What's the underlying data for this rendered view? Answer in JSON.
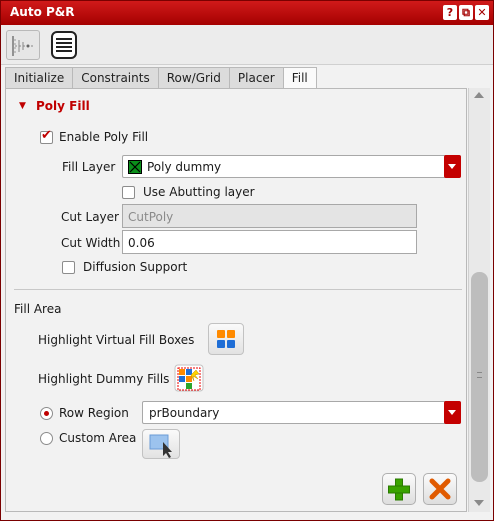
{
  "window": {
    "title": "Auto P&R",
    "buttons": [
      "?",
      "⧉",
      "✕"
    ]
  },
  "toolbar": {
    "icons": [
      "tree-view-icon",
      "list-view-icon"
    ]
  },
  "tabs": [
    {
      "label": "Initialize"
    },
    {
      "label": "Constraints"
    },
    {
      "label": "Row/Grid"
    },
    {
      "label": "Placer"
    },
    {
      "label": "Fill",
      "active": true
    }
  ],
  "poly_fill": {
    "section_title": "Poly Fill",
    "enable_label": "Enable Poly Fill",
    "enable_checked": true,
    "fill_layer_label": "Fill Layer",
    "fill_layer_value": "Poly dummy",
    "use_abutting_label": "Use Abutting layer",
    "use_abutting_checked": false,
    "cut_layer_label": "Cut Layer",
    "cut_layer_value": "CutPoly",
    "cut_width_label": "Cut Width",
    "cut_width_value": "0.06",
    "diffusion_label": "Diffusion Support",
    "diffusion_checked": false
  },
  "fill_area": {
    "section_title": "Fill Area",
    "highlight_virtual_label": "Highlight Virtual Fill Boxes",
    "highlight_dummy_label": "Highlight Dummy Fills",
    "row_region_label": "Row Region",
    "row_region_selected": true,
    "row_region_value": "prBoundary",
    "custom_area_label": "Custom Area",
    "custom_area_selected": false
  },
  "actions": {
    "add_icon": "plus-icon",
    "delete_icon": "delete-x-icon"
  },
  "colors": {
    "accent": "#c40000",
    "title_bar": "#b80000",
    "add_green": "#3aa300",
    "delete_orange": "#e05a00"
  }
}
